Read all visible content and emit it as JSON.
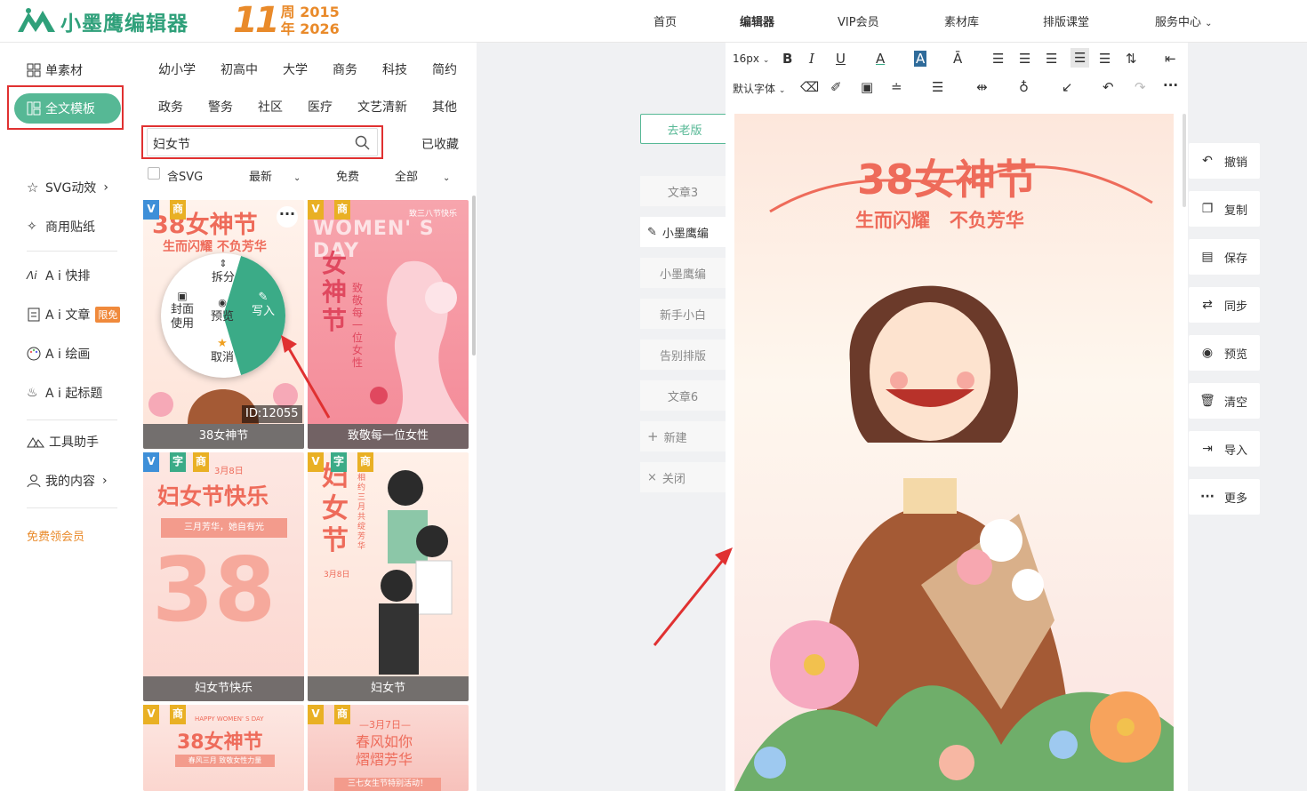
{
  "header": {
    "logo_text": "小墨鹰编辑器",
    "anniv_num": "11",
    "anniv_line1": "周 2015",
    "anniv_line2": "年 2026",
    "nav": [
      {
        "label": "首页"
      },
      {
        "label": "编辑器"
      },
      {
        "label": "VIP会员"
      },
      {
        "label": "素材库"
      },
      {
        "label": "排版课堂"
      },
      {
        "label": "服务中心"
      }
    ]
  },
  "sidebar": {
    "items": [
      {
        "label": "单素材"
      },
      {
        "label": "全文模板"
      },
      {
        "label": "SVG动效"
      },
      {
        "label": "商用贴纸"
      },
      {
        "label": "A i 快排"
      },
      {
        "label": "A i 文章"
      },
      {
        "label": "A i 绘画"
      },
      {
        "label": "A i 起标题"
      },
      {
        "label": "工具助手"
      },
      {
        "label": "我的内容"
      }
    ],
    "limit_badge": "限免",
    "free_vip": "免费领会员"
  },
  "panel": {
    "categories": [
      "幼小学",
      "初高中",
      "大学",
      "商务",
      "科技",
      "简约",
      "政务",
      "警务",
      "社区",
      "医疗",
      "文艺清新",
      "其他"
    ],
    "search_value": "妇女节",
    "favorites": "已收藏",
    "filter_svg": "含SVG",
    "filter_sort": "最新",
    "filter_price": "免费",
    "filter_all": "全部",
    "cards": [
      {
        "label": "38女神节",
        "poster_title": "38女神节",
        "poster_sub": "生而闪耀 不负芳华",
        "id_text": "ID:12055"
      },
      {
        "label": "致敬每一位女性",
        "poster_title": "女神节",
        "poster_sub": "WOMEN' S DAY",
        "poster_side": "致敬每一位女性",
        "poster_top": "致三八节快乐"
      },
      {
        "label": "妇女节快乐",
        "poster_title": "妇女节快乐",
        "poster_sub": "三月芳华，她自有光",
        "poster_num": "38",
        "poster_date": "3月8日"
      },
      {
        "label": "妇女节",
        "poster_title": "妇女节",
        "poster_date": "3月8日",
        "poster_side": "相约三月 共绽芳华"
      },
      {
        "label": "",
        "poster_title": "38女神节",
        "poster_top": "HAPPY WOMEN' S DAY",
        "poster_sub": "春风三月 致敬女性力量"
      },
      {
        "label": "",
        "poster_title": "春风如你\n熠熠芳华",
        "poster_top": "—3月7日—",
        "poster_sub": "三七女生节特别活动！"
      }
    ],
    "tags": {
      "v": "V",
      "shang": "商",
      "zi": "字"
    },
    "pie_menu": {
      "split": "拆分",
      "cover": "封面\n使用",
      "preview": "预览",
      "write": "写入",
      "cancel": "取消"
    }
  },
  "center": {
    "old_version": "去老版",
    "tabs": [
      {
        "label": "文章3"
      },
      {
        "label": "小墨鹰编"
      },
      {
        "label": "小墨鹰编"
      },
      {
        "label": "新手小白"
      },
      {
        "label": "告别排版"
      },
      {
        "label": "文章6"
      },
      {
        "label": "新建"
      },
      {
        "label": "关闭"
      }
    ]
  },
  "editor": {
    "font_size": "16px",
    "font_family": "默认字体",
    "poster_title": "38女神节",
    "poster_sub": "生而闪耀   不负芳华"
  },
  "right_actions": [
    {
      "label": "撤销"
    },
    {
      "label": "复制"
    },
    {
      "label": "保存"
    },
    {
      "label": "同步"
    },
    {
      "label": "预览"
    },
    {
      "label": "清空"
    },
    {
      "label": "导入"
    },
    {
      "label": "更多"
    }
  ],
  "colors": {
    "brand_green": "#56b895",
    "highlight_red": "#e03131",
    "accent_orange": "#e98a2a",
    "poster_title": "#ee6b5a"
  }
}
